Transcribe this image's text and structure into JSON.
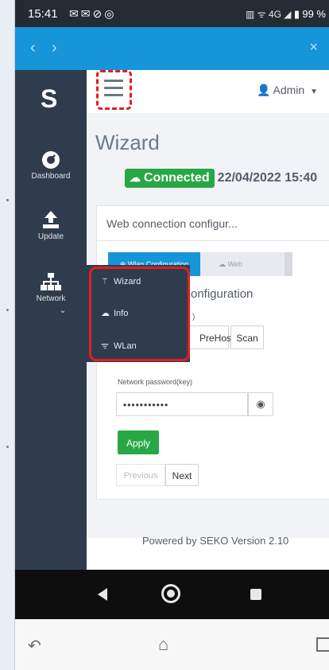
{
  "status_bar": {
    "time": "15:41",
    "left_icons": "✉✉⊘◎",
    "network": "4G",
    "battery": "99 %"
  },
  "browser": {
    "back": "‹",
    "forward": "›",
    "close": "×"
  },
  "sidebar": {
    "logo": "S",
    "items": [
      {
        "label": "Dashboard",
        "icon": "dashboard-gauge-icon"
      },
      {
        "label": "Update",
        "icon": "upload-icon"
      },
      {
        "label": "Network",
        "icon": "network-icon"
      }
    ]
  },
  "topbar": {
    "user": "Admin"
  },
  "page": {
    "title": "Wizard",
    "connection_status": "Connected",
    "datetime": "22/04/2022 15:40"
  },
  "card": {
    "header": "Web connection configur...",
    "tabs": [
      {
        "label": "Wlan Configuration",
        "active": true
      },
      {
        "label": "Web",
        "active": false
      }
    ],
    "section_heading": "onfiguration",
    "ssid_label_fragment": ")",
    "ssid_value": "PreHos",
    "scan_label": "Scan",
    "password_label": "Network password(key)",
    "password_value": "•••••••••••",
    "apply_label": "Apply",
    "previous_label": "Previous",
    "next_label": "Next"
  },
  "dropdown": {
    "items": [
      {
        "label": "Wizard",
        "icon": "magic-wand-icon"
      },
      {
        "label": "Info",
        "icon": "cloud-icon"
      },
      {
        "label": "WLan",
        "icon": "wifi-icon"
      }
    ]
  },
  "footer": {
    "text": "Powered by SEKO Version 2.10"
  },
  "colors": {
    "sidebar_bg": "#2f3c4d",
    "browser_bar": "#1695d9",
    "success": "#28a745",
    "highlight": "#e02020"
  }
}
